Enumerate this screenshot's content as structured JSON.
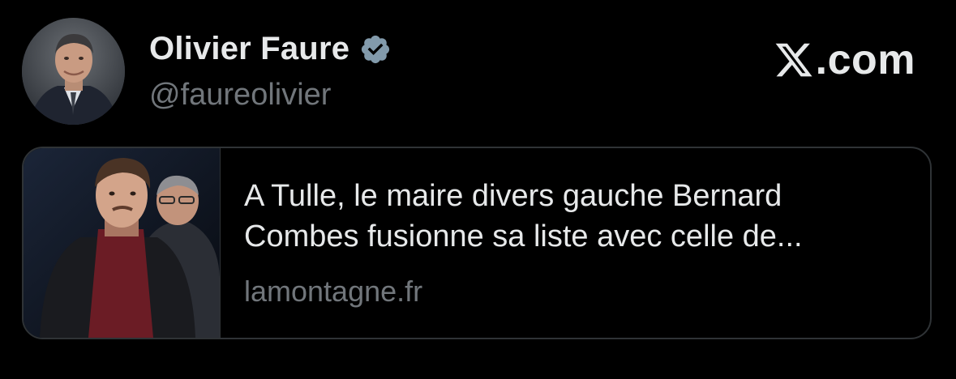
{
  "author": {
    "display_name": "Olivier Faure",
    "handle": "@faureolivier",
    "verified": true,
    "avatar_icon": "profile-photo"
  },
  "brand": {
    "label": ".com",
    "logo_icon": "x-logo-icon"
  },
  "link_card": {
    "title_line1": "A Tulle, le maire divers gauche Bernard",
    "title_line2": "Combes fusionne sa liste avec celle de...",
    "domain": "lamontagne.fr",
    "thumbnail_icon": "news-photo"
  },
  "colors": {
    "background": "#000000",
    "primary_text": "#e7e9ea",
    "secondary_text": "#71767b",
    "verified_badge": "#829aab",
    "card_border": "#2f3336"
  }
}
